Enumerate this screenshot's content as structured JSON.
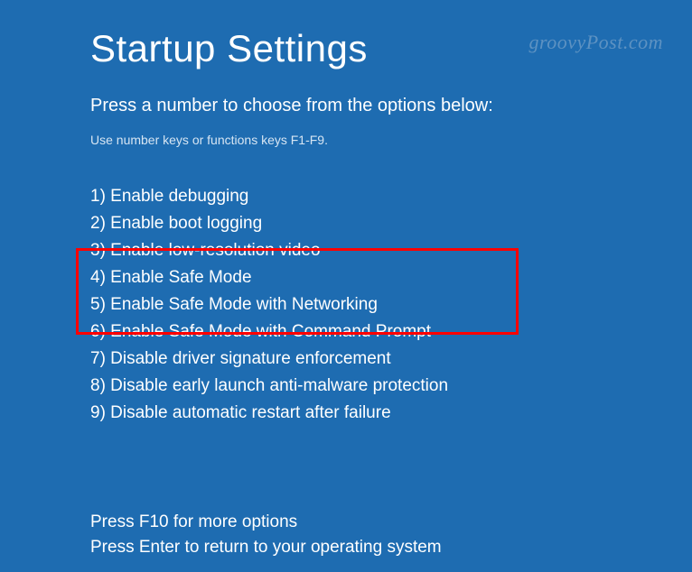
{
  "title": "Startup Settings",
  "subtitle": "Press a number to choose from the options below:",
  "hint": "Use number keys or functions keys F1-F9.",
  "options": [
    "1) Enable debugging",
    "2) Enable boot logging",
    "3) Enable low-resolution video",
    "4) Enable Safe Mode",
    "5) Enable Safe Mode with Networking",
    "6) Enable Safe Mode with Command Prompt",
    "7) Disable driver signature enforcement",
    "8) Disable early launch anti-malware protection",
    "9) Disable automatic restart after failure"
  ],
  "footer": {
    "more": "Press F10 for more options",
    "return": "Press Enter to return to your operating system"
  },
  "watermark": "groovyPost.com"
}
